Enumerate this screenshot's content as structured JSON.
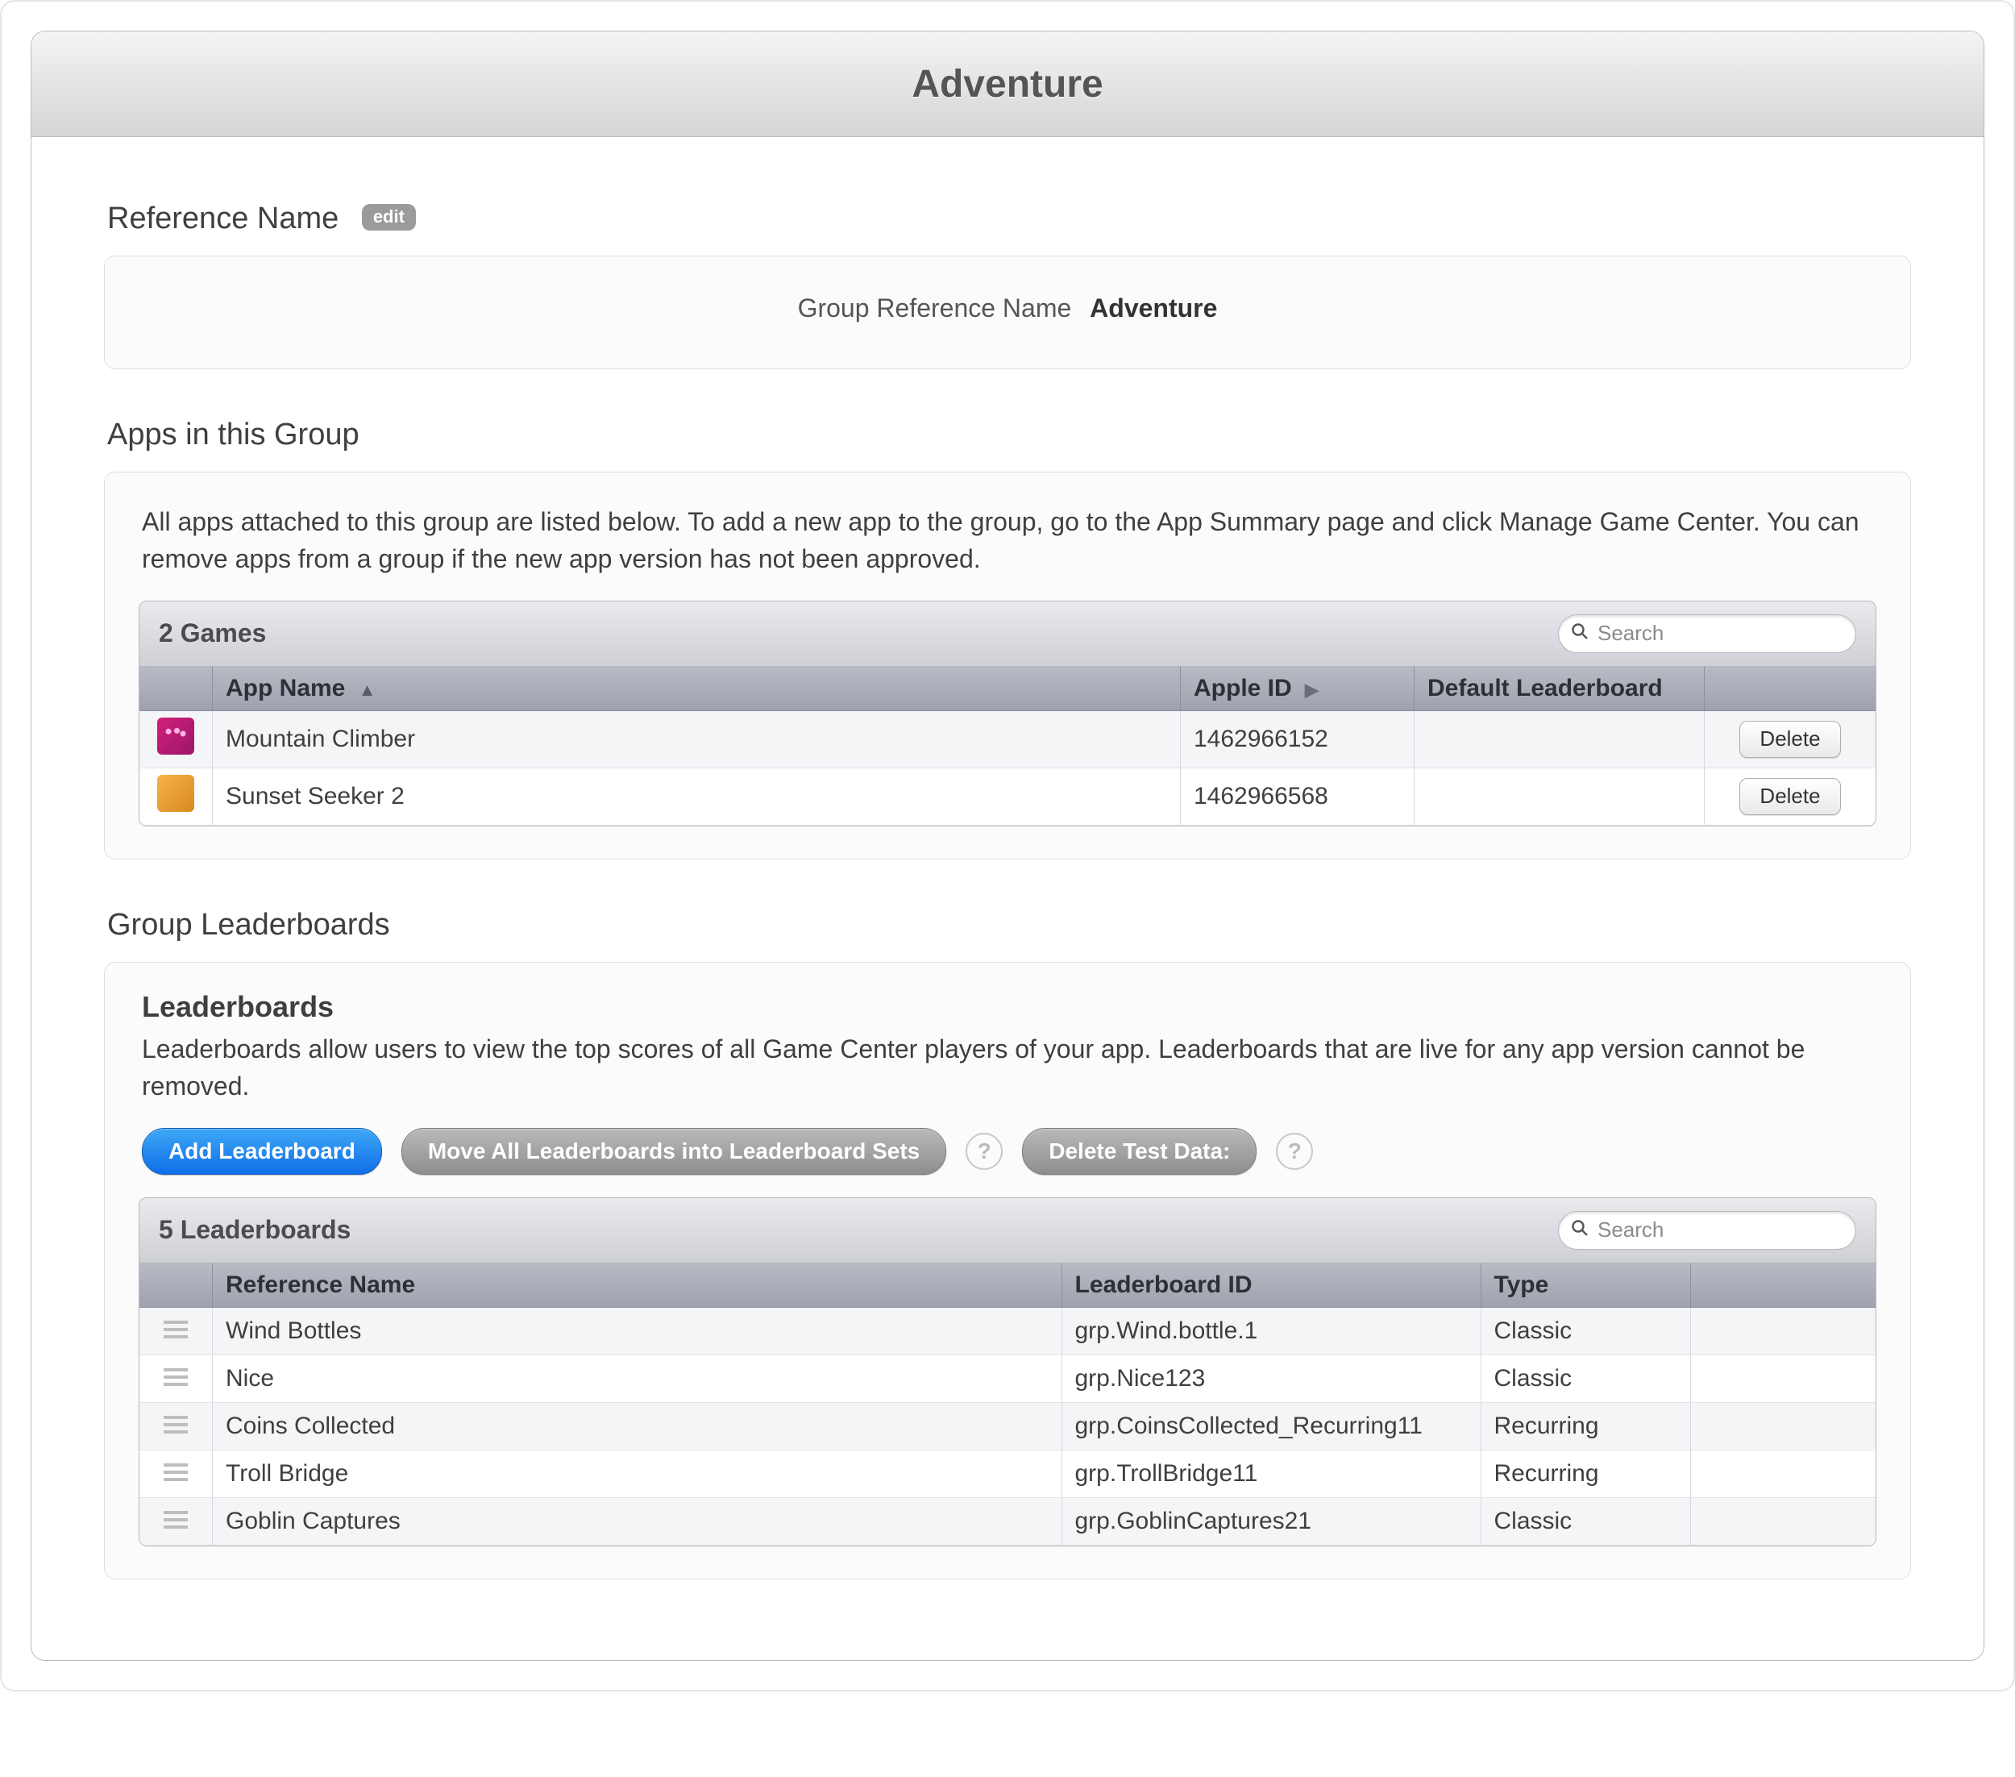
{
  "header": {
    "title": "Adventure"
  },
  "reference": {
    "heading": "Reference Name",
    "edit_label": "edit",
    "kv_label": "Group Reference Name",
    "kv_value": "Adventure"
  },
  "apps_section": {
    "heading": "Apps in this Group",
    "description": "All apps attached to this group are listed below. To add a new app to the group, go to the App Summary page and click Manage Game Center. You can remove apps from a group if the new app version has not been approved.",
    "table_title": "2 Games",
    "search_placeholder": "Search",
    "columns": {
      "app_name": "App Name",
      "apple_id": "Apple ID",
      "default_leaderboard": "Default Leaderboard"
    },
    "delete_label": "Delete",
    "rows": [
      {
        "icon": "pink",
        "name": "Mountain Climber",
        "apple_id": "1462966152",
        "leaderboard": ""
      },
      {
        "icon": "orange",
        "name": "Sunset Seeker 2",
        "apple_id": "1462966568",
        "leaderboard": ""
      }
    ]
  },
  "leaderboards_section": {
    "heading": "Group Leaderboards",
    "panel_subheading": "Leaderboards",
    "description": "Leaderboards allow users to view the top scores of all Game Center players of your app. Leaderboards that are live for any app version cannot be removed.",
    "buttons": {
      "add": "Add Leaderboard",
      "move_all": "Move All Leaderboards into Leaderboard Sets",
      "delete_test": "Delete Test Data:"
    },
    "table_title": "5 Leaderboards",
    "search_placeholder": "Search",
    "columns": {
      "ref_name": "Reference Name",
      "lb_id": "Leaderboard ID",
      "type": "Type"
    },
    "rows": [
      {
        "ref": "Wind Bottles",
        "id": "grp.Wind.bottle.1",
        "type": "Classic"
      },
      {
        "ref": "Nice",
        "id": "grp.Nice123",
        "type": "Classic"
      },
      {
        "ref": "Coins Collected",
        "id": "grp.CoinsCollected_Recurring11",
        "type": "Recurring"
      },
      {
        "ref": "Troll Bridge",
        "id": "grp.TrollBridge11",
        "type": "Recurring"
      },
      {
        "ref": "Goblin Captures",
        "id": "grp.GoblinCaptures21",
        "type": "Classic"
      }
    ]
  },
  "help_tooltip": "?"
}
